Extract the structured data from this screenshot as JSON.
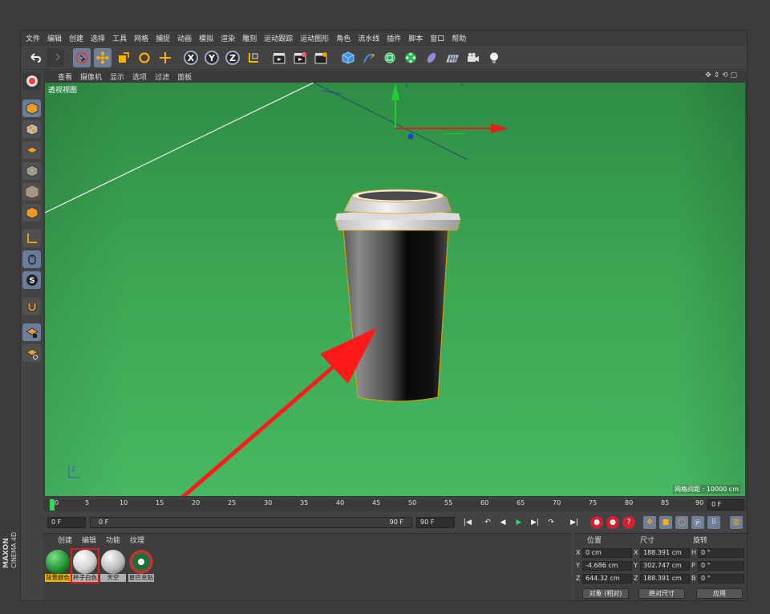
{
  "menu": [
    "文件",
    "编辑",
    "创建",
    "选择",
    "工具",
    "网格",
    "捕捉",
    "动画",
    "模拟",
    "渲染",
    "雕刻",
    "运动跟踪",
    "运动图形",
    "角色",
    "流水线",
    "插件",
    "脚本",
    "窗口",
    "帮助"
  ],
  "toolbar": {
    "xyz": [
      "X",
      "Y",
      "Z"
    ]
  },
  "viewport": {
    "menu": [
      "查看",
      "摄像机",
      "显示",
      "选项",
      "过滤",
      "面板"
    ],
    "label": "透视视图",
    "grid_info": "网格间距 : 10000 cm"
  },
  "timeline": {
    "ticks": [
      "0",
      "5",
      "10",
      "15",
      "20",
      "25",
      "30",
      "35",
      "40",
      "45",
      "50",
      "55",
      "60",
      "65",
      "70",
      "75",
      "80",
      "85",
      "90"
    ],
    "current_frame": "0 F",
    "start_field": "0 F",
    "range_start": "0 F",
    "range_end": "90 F",
    "end_field": "90 F"
  },
  "material_manager": {
    "tabs": [
      "创建",
      "编辑",
      "功能",
      "纹理"
    ],
    "materials": [
      {
        "label": "背景颜色",
        "color": "#3aa645"
      },
      {
        "label": "杯子白色",
        "color": "#e9e9e9"
      },
      {
        "label": "天空",
        "color": "#d9d9d9"
      },
      {
        "label": "星巴克贴",
        "color": "#b43a3a"
      }
    ]
  },
  "coords": {
    "headers": [
      "位置",
      "尺寸",
      "旋转"
    ],
    "rows": [
      {
        "axis": "X",
        "pos": "0 cm",
        "size_axis": "X",
        "size": "188.391 cm",
        "rot_axis": "H",
        "rot": "0 °"
      },
      {
        "axis": "Y",
        "pos": "-4.686 cm",
        "size_axis": "Y",
        "size": "302.747 cm",
        "rot_axis": "P",
        "rot": "0 °"
      },
      {
        "axis": "Z",
        "pos": "644.32 cm",
        "size_axis": "Z",
        "size": "188.391 cm",
        "rot_axis": "B",
        "rot": "0 °"
      }
    ],
    "mode_select": "对象 (相对)",
    "size_select": "绝对尺寸",
    "apply": "应用"
  },
  "brand": {
    "line1": "MAXON",
    "line2": "CINEMA 4D"
  },
  "colors": {
    "accent": "#6f7f99",
    "viewport_green": "#46b862",
    "arrow_red": "#ff1a1a",
    "highlight_box": "#e01b1b"
  }
}
